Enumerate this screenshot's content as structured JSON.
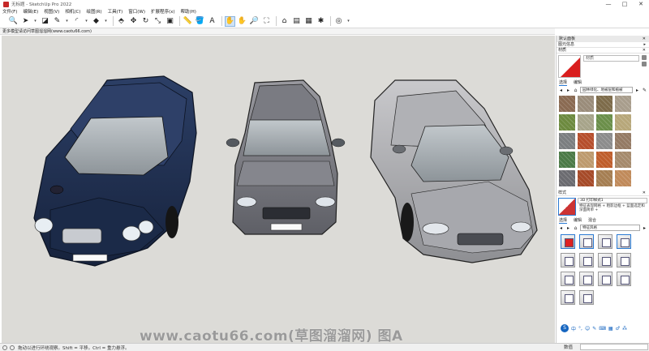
{
  "window": {
    "title": "无标题 - SketchUp Pro 2022",
    "controls": [
      "—",
      "□",
      "✕"
    ]
  },
  "menu": [
    "文件(F)",
    "编辑(E)",
    "视图(V)",
    "相机(C)",
    "绘图(R)",
    "工具(T)",
    "窗口(W)",
    "扩展程序(x)",
    "帮助(H)"
  ],
  "toolbar": {
    "icons": [
      {
        "name": "search-icon",
        "glyph": "🔍"
      },
      {
        "name": "select-arrow-icon",
        "glyph": "➤"
      },
      {
        "name": "dropdown-chevron-icon",
        "glyph": "▾",
        "small": true
      },
      {
        "name": "eraser-icon",
        "glyph": "◪"
      },
      {
        "name": "line-pencil-icon",
        "glyph": "✎"
      },
      {
        "name": "dropdown-chevron-icon",
        "glyph": "▾",
        "small": true
      },
      {
        "name": "arc-icon",
        "glyph": "◜"
      },
      {
        "name": "dropdown-chevron-icon",
        "glyph": "▾",
        "small": true
      },
      {
        "name": "shape-icon",
        "glyph": "◆"
      },
      {
        "name": "dropdown-chevron-icon",
        "glyph": "▾",
        "small": true
      },
      {
        "sep": true
      },
      {
        "name": "push-pull-icon",
        "glyph": "⬘"
      },
      {
        "name": "move-icon",
        "glyph": "✥"
      },
      {
        "name": "rotate-icon",
        "glyph": "↻"
      },
      {
        "name": "scale-icon",
        "glyph": "⤡"
      },
      {
        "name": "offset-icon",
        "glyph": "▣"
      },
      {
        "sep": true
      },
      {
        "name": "tape-measure-icon",
        "glyph": "📏"
      },
      {
        "name": "paint-bucket-icon",
        "glyph": "🪣"
      },
      {
        "name": "text-icon",
        "glyph": "A"
      },
      {
        "sep": true
      },
      {
        "name": "orbit-icon",
        "glyph": "✋",
        "selected": true
      },
      {
        "name": "pan-icon",
        "glyph": "✋"
      },
      {
        "name": "zoom-icon",
        "glyph": "🔎"
      },
      {
        "name": "zoom-extents-icon",
        "glyph": "⛶"
      },
      {
        "sep": true
      },
      {
        "name": "warehouse-icon",
        "glyph": "⌂"
      },
      {
        "name": "extension-warehouse-icon",
        "glyph": "▤"
      },
      {
        "name": "layout-icon",
        "glyph": "▦"
      },
      {
        "name": "extension-manager-icon",
        "glyph": "✱"
      },
      {
        "sep": true
      },
      {
        "name": "account-icon",
        "glyph": "◎"
      },
      {
        "name": "dropdown-chevron-icon",
        "glyph": "▾",
        "small": true
      }
    ]
  },
  "hint_bar": "更多模型请访问草图溜溜网(www.caotu66.com)",
  "viewport": {
    "watermark": "www.caotu66.com(草图溜溜网) 图A"
  },
  "tray": {
    "title": "默认面板",
    "sections": {
      "scene_info": "图元信息",
      "materials": "材质",
      "styles": "样式"
    },
    "material": {
      "name_placeholder": "材质"
    },
    "tabs": {
      "select": "选择",
      "edit": "编辑",
      "mix": "混合"
    },
    "library": "园林绿化、地被层和植被",
    "swatch_colors": [
      "#8a6a52",
      "#9a8c7a",
      "#7d6b4a",
      "#a89d8c",
      "#6d8a3f",
      "#a7a48a",
      "#6b8f4a",
      "#b7a77a",
      "#7b7e80",
      "#b64e2c",
      "#8c8c8c",
      "#947a64",
      "#4c7a47",
      "#bd9a6e",
      "#bf5e2c",
      "#a58a6c",
      "#6b6b70",
      "#a64a28",
      "#a57e52",
      "#c08a5a"
    ],
    "style": {
      "name": "3D 打印样式1",
      "desc": "特征表现网格 + 粗影边框 + 蓝面选定和深面简单 +"
    },
    "style_library": "特征风格",
    "style_count": 14,
    "ime": [
      "S",
      "中",
      "°,",
      "☺",
      "✎",
      "⌨",
      "▦",
      "♂",
      "⁂"
    ]
  },
  "statusbar": {
    "hint": "拖动以进行环绕观察。Shift = 平移。Ctrl = 重力悬浮。",
    "measure_label": "数值"
  }
}
